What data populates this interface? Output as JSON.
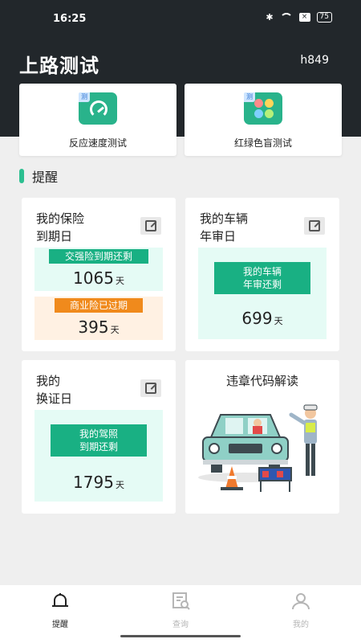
{
  "status_bar": {
    "time": "16:25",
    "battery": "75"
  },
  "header": {
    "title": "上路测试",
    "user_id": "h849"
  },
  "features": [
    {
      "label": "反应速度测试",
      "icon": "speedometer-icon",
      "badge": "测"
    },
    {
      "label": "红绿色盲测试",
      "icon": "color-petals-icon",
      "badge": "测"
    }
  ],
  "section": {
    "title": "提醒"
  },
  "insurance_card": {
    "title": "我的保险\n到期日",
    "compulsory_label": "交强险到期还剩",
    "compulsory_days": "1065",
    "commercial_label": "商业险已过期",
    "commercial_days": "395",
    "unit": "天"
  },
  "vehicle_card": {
    "title": "我的车辆\n年审日",
    "pill_label_1": "我的车辆",
    "pill_label_2": "年审还剩",
    "days": "699",
    "unit": "天"
  },
  "license_card": {
    "title": "我的\n换证日",
    "pill_label_1": "我的驾照",
    "pill_label_2": "到期还剩",
    "days": "1795",
    "unit": "天"
  },
  "violation_card": {
    "title": "违章代码解读"
  },
  "bottom_nav": [
    {
      "label": "提醒",
      "icon": "bell-icon",
      "active": true
    },
    {
      "label": "查询",
      "icon": "search-document-icon",
      "active": false
    },
    {
      "label": "我的",
      "icon": "user-icon",
      "active": false
    }
  ],
  "colors": {
    "header_bg": "#22272b",
    "accent": "#19b083",
    "warning": "#f08a1c",
    "mint": "#e5fbf5",
    "peach": "#fff1e3"
  }
}
